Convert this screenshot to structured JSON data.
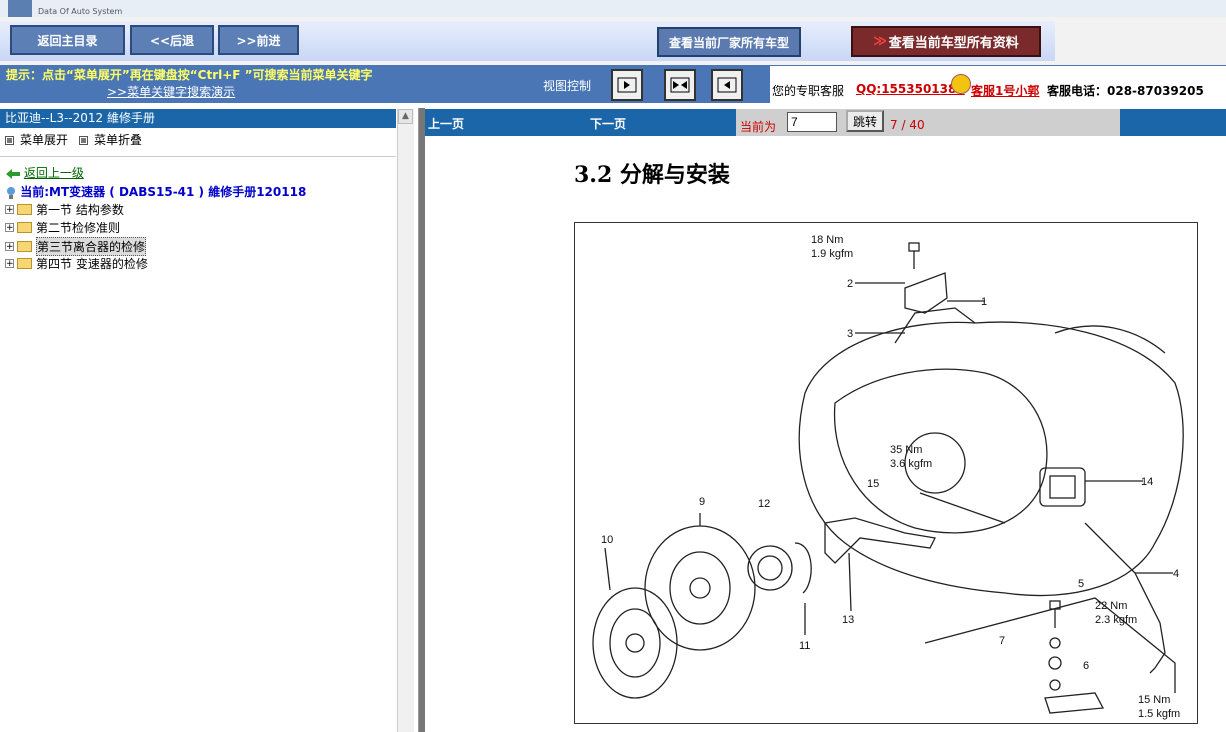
{
  "logo": {
    "subtitle": "Data Of Auto System"
  },
  "toolbar": {
    "home_label": "返回主目录",
    "back_label": "<<后退",
    "forward_label": ">>前进",
    "factory_models_label": "查看当前厂家所有车型",
    "all_docs_arrow": "≫",
    "all_docs_label": "查看当前车型所有资料"
  },
  "tipbar": {
    "tip": "提示：点击“菜单展开”再在键盘按“Ctrl+F ”可搜索当前菜单关键字",
    "demo_link": ">>菜单关键字搜索演示",
    "view_label": "视图控制",
    "service_label": "您的专职客服",
    "service_qq": "QQ:1553501388",
    "service_name": "客服1号小郭",
    "service_phone": "客服电话：028-87039205"
  },
  "left": {
    "header": "比亚迪--L3--2012 維修手册",
    "expand_label": "菜单展开",
    "collapse_label": "菜单折叠",
    "back_label": "返回上一级",
    "current_label": "当前:MT变速器 ( DABS15-41 ) 維修手册120118",
    "tree": [
      {
        "label": "第一节  结构参数"
      },
      {
        "label": "第二节检修准则"
      },
      {
        "label": "第三节离合器的检修"
      },
      {
        "label": "第四节  变速器的检修"
      }
    ]
  },
  "pager": {
    "prev_label": "上一页",
    "next_label": "下一页",
    "current_label": "当前为",
    "current_page": "7",
    "jump_label": "跳转",
    "count": "7 / 40"
  },
  "document": {
    "title": "3.2 分解与安装",
    "figure_labels": {
      "torque_top_a": "18 Nm",
      "torque_top_b": "1.9 kgfm",
      "torque_mid_a": "35 Nm",
      "torque_mid_b": "3.6 kgfm",
      "torque_r_a": "22 Nm",
      "torque_r_b": "2.3 kgfm",
      "torque_b_a": "15 Nm",
      "torque_b_b": "1.5 kgfm",
      "n1": "1",
      "n2": "2",
      "n3": "3",
      "n4": "4",
      "n5": "5",
      "n6": "6",
      "n7": "7",
      "n9": "9",
      "n10": "10",
      "n11": "11",
      "n12": "12",
      "n13": "13",
      "n14": "14",
      "n15": "15"
    }
  }
}
